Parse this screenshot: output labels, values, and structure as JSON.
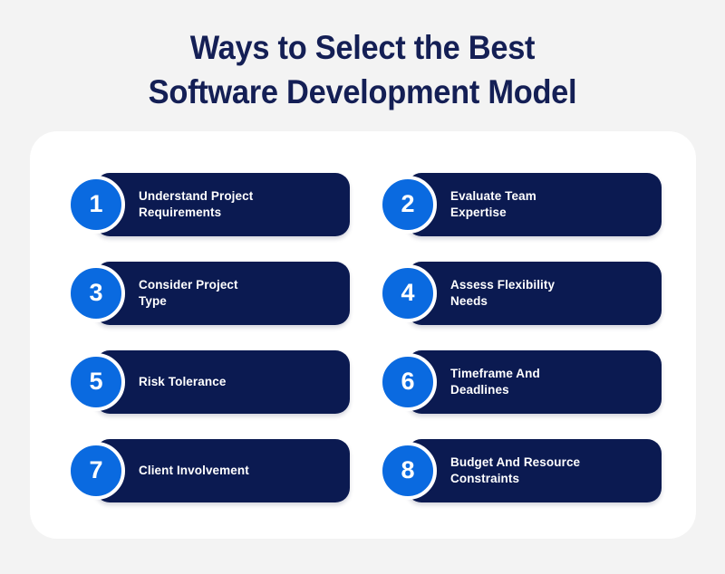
{
  "background_color": "#f3f3f3",
  "panel_color": "#ffffff",
  "accent_colors": {
    "badge_blue": "#0a6ae0",
    "card_navy": "#0b1a51",
    "title_navy": "#141f55",
    "card_text": "#ffffff"
  },
  "title": {
    "line1": "Ways to Select the Best",
    "line2": "Software Development Model"
  },
  "steps": [
    {
      "number": "1",
      "label": "Understand Project\nRequirements"
    },
    {
      "number": "2",
      "label": "Evaluate Team\nExpertise"
    },
    {
      "number": "3",
      "label": "Consider Project\nType"
    },
    {
      "number": "4",
      "label": "Assess Flexibility\nNeeds"
    },
    {
      "number": "5",
      "label": "Risk Tolerance"
    },
    {
      "number": "6",
      "label": "Timeframe And\nDeadlines"
    },
    {
      "number": "7",
      "label": "Client Involvement"
    },
    {
      "number": "8",
      "label": "Budget And Resource\nConstraints"
    }
  ]
}
